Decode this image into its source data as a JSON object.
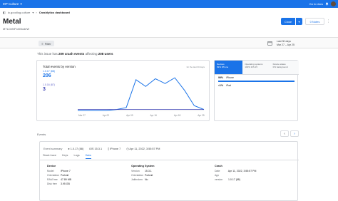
{
  "topbar": {
    "project": "MP Culture",
    "docs": "Go to docs",
    "colors": {
      "bar": "#1a73e8"
    }
  },
  "breadcrumb": {
    "app": "io.goodlog.culture",
    "page": "Crashlytics dashboard"
  },
  "issue": {
    "title": "Metal",
    "subtitle": "MTLDeNPortModeW",
    "close_label": "Close",
    "notes_label": "0 Notes"
  },
  "filter": {
    "label": "Filter",
    "date_title": "Last 30 days",
    "date_range": "Mar 27 – Apr 25"
  },
  "summary": {
    "prefix": "This issue has",
    "crashes": "209 crash events",
    "middle": "affecting",
    "users": "208 users"
  },
  "chart_panel": {
    "title": "Total events by version",
    "note": "for the last 30 days",
    "series1_label": "1.0.17 (88)",
    "series1_value": "206",
    "series2_label": "1.0.16 (87)",
    "series2_value": "3"
  },
  "chart_data": {
    "type": "line",
    "x": [
      "Mar 27",
      "Apr 01",
      "Apr 04",
      "Apr 09",
      "Apr 12",
      "Apr 14",
      "Apr 15",
      "Apr 16",
      "Apr 18",
      "Apr 19",
      "Apr 20",
      "Apr 22",
      "Apr 23",
      "Apr 25"
    ],
    "x_tick_labels": [
      "Mar 27",
      "Apr 02",
      "Apr 09",
      "Apr 16",
      "Apr 18",
      "Apr 25"
    ],
    "series": [
      {
        "name": "1.0.17 (88)",
        "color": "#1a73e8",
        "values": [
          0,
          0,
          0,
          0,
          1,
          3,
          32,
          25,
          33,
          28,
          34,
          21,
          5,
          1
        ]
      },
      {
        "name": "1.0.16 (87)",
        "color": "#3f44b5",
        "values": [
          1,
          1,
          1,
          1,
          1,
          1,
          1,
          1,
          1,
          1,
          1,
          1,
          1,
          1
        ]
      }
    ],
    "ylim": [
      0,
      40
    ]
  },
  "distribution": {
    "tabs": [
      {
        "title": "Devices",
        "sub": "99% iPhone"
      },
      {
        "title": "Operating systems",
        "sub": "100% iOS 15"
      },
      {
        "title": "Device states",
        "sub": "0% background"
      }
    ],
    "rows": [
      {
        "pct": "99%",
        "name": "iPhone",
        "fraction": 0.99
      },
      {
        "pct": "<1%",
        "name": "iPad",
        "fraction": 0.01
      }
    ]
  },
  "events": {
    "label": "Events",
    "summary_label": "Event summary",
    "version": "1.0.17 (88)",
    "os": "iOS 15.3.1",
    "device": "iPhone 7",
    "time": "Apr 11, 2022, 3:55:57 PM",
    "tabs": [
      "Stack trace",
      "Keys",
      "Logs",
      "Data"
    ],
    "active_tab": "Data",
    "device_col": {
      "header": "Device",
      "rows": [
        {
          "k": "Model",
          "v": "iPhone 7"
        },
        {
          "k": "Orientation",
          "v": "Portrait"
        },
        {
          "k": "RAM free",
          "v": "47.89 MB"
        },
        {
          "k": "Disk free",
          "v": "3.95 GB"
        }
      ]
    },
    "os_col": {
      "header": "Operating System",
      "rows": [
        {
          "k": "Version",
          "v": "15.3.1"
        },
        {
          "k": "Orientation",
          "v": "Portrait"
        },
        {
          "k": "Jailbroken",
          "v": "No"
        }
      ]
    },
    "crash_col": {
      "header": "Crash",
      "rows": [
        {
          "k": "Date",
          "v": "Apr 11, 2022, 3:55:57 PM"
        },
        {
          "k": "App version",
          "v": "1.0.17 (88)"
        }
      ]
    }
  }
}
